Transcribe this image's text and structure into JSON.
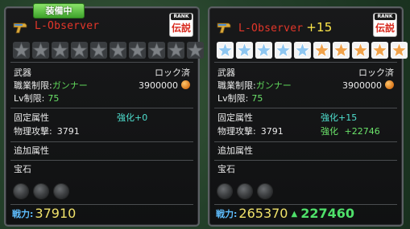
{
  "left_card": {
    "tag": "装備中",
    "name": "L-Observer",
    "rank_label": "RANK",
    "rank_value": "伝説",
    "stars": [
      0,
      0,
      0,
      0,
      0,
      0,
      0,
      0,
      0,
      0
    ],
    "category": "武器",
    "lock_status": "ロック済",
    "job_label": "職業制限:",
    "job_value": "ガンナー",
    "price": "3900000",
    "lv_label": "Lv制限:",
    "lv_value": "75",
    "fixed_attr": "固定属性",
    "enh_label": "強化+0",
    "phys_label": "物理攻撃:",
    "phys_value": "3791",
    "extra_attr": "追加属性",
    "gem_label": "宝石",
    "power_label": "戦力:",
    "power_value": "37910"
  },
  "right_card": {
    "name": "L-Observer",
    "plus": "+15",
    "rank_label": "RANK",
    "rank_value": "伝説",
    "stars": [
      1,
      1,
      1,
      1,
      1,
      2,
      2,
      2,
      2,
      2
    ],
    "category": "武器",
    "lock_status": "ロック済",
    "job_label": "職業制限:",
    "job_value": "ガンナー",
    "price": "3900000",
    "lv_label": "Lv制限:",
    "lv_value": "75",
    "fixed_attr": "固定属性",
    "enh_label": "強化+15",
    "phys_label": "物理攻撃:",
    "phys_value": "3791",
    "enh_bonus_label": "強化",
    "enh_bonus_value": "+22746",
    "extra_attr": "追加属性",
    "gem_label": "宝石",
    "power_label": "戦力:",
    "power_value": "265370",
    "power_diff": "227460"
  },
  "colors": {
    "star_empty": "#7c8084",
    "star_blue": "#8ec6f0",
    "star_orange": "#f0a24a"
  }
}
